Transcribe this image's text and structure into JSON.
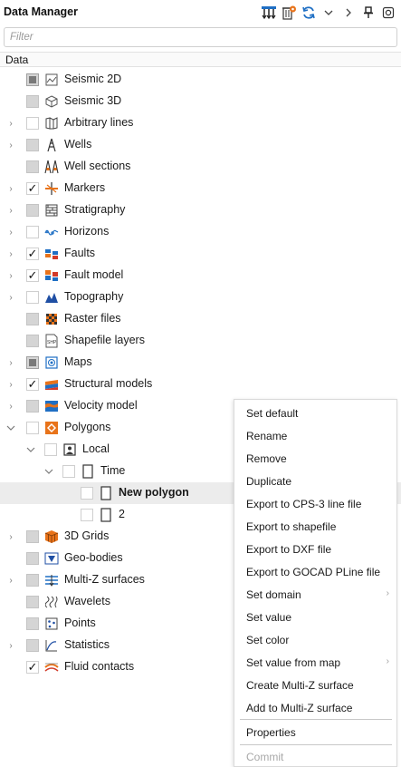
{
  "header": {
    "title": "Data Manager",
    "icons": [
      "import-icon",
      "delete-settings-icon",
      "refresh-icon",
      "chevron-down-icon",
      "chevron-right-icon",
      "pin-icon",
      "settings-icon"
    ]
  },
  "filter": {
    "placeholder": "Filter",
    "value": ""
  },
  "column_header": "Data",
  "tree": {
    "items": [
      {
        "label": "Seismic 2D",
        "icon": "seismic-2d-icon",
        "expandable": false,
        "check": "partial-dark"
      },
      {
        "label": "Seismic 3D",
        "icon": "seismic-3d-icon",
        "expandable": false,
        "check": "partial"
      },
      {
        "label": "Arbitrary lines",
        "icon": "arbitrary-lines-icon",
        "expandable": true,
        "check": "empty"
      },
      {
        "label": "Wells",
        "icon": "wells-icon",
        "expandable": true,
        "check": "partial"
      },
      {
        "label": "Well sections",
        "icon": "well-sections-icon",
        "expandable": false,
        "check": "partial"
      },
      {
        "label": "Markers",
        "icon": "markers-icon",
        "expandable": true,
        "check": "checked"
      },
      {
        "label": "Stratigraphy",
        "icon": "stratigraphy-icon",
        "expandable": true,
        "check": "partial"
      },
      {
        "label": "Horizons",
        "icon": "horizons-icon",
        "expandable": true,
        "check": "empty"
      },
      {
        "label": "Faults",
        "icon": "faults-icon",
        "expandable": true,
        "check": "checked"
      },
      {
        "label": "Fault model",
        "icon": "fault-model-icon",
        "expandable": true,
        "check": "checked"
      },
      {
        "label": "Topography",
        "icon": "topography-icon",
        "expandable": true,
        "check": "empty"
      },
      {
        "label": "Raster files",
        "icon": "raster-files-icon",
        "expandable": false,
        "check": "partial"
      },
      {
        "label": "Shapefile layers",
        "icon": "shapefile-icon",
        "expandable": false,
        "check": "partial"
      },
      {
        "label": "Maps",
        "icon": "maps-icon",
        "expandable": true,
        "check": "partial-dark"
      },
      {
        "label": "Structural models",
        "icon": "structural-models-icon",
        "expandable": true,
        "check": "checked"
      },
      {
        "label": "Velocity model",
        "icon": "velocity-model-icon",
        "expandable": true,
        "check": "partial"
      },
      {
        "label": "Polygons",
        "icon": "polygons-icon",
        "expandable": true,
        "expanded": true,
        "check": "empty"
      },
      {
        "label": "Local",
        "icon": "user-folder-icon",
        "expandable": true,
        "expanded": true,
        "check": "empty"
      },
      {
        "label": "Time",
        "icon": "document-icon",
        "expandable": true,
        "expanded": true,
        "check": "empty"
      },
      {
        "label": "New polygon",
        "icon": "document-icon",
        "expandable": false,
        "check": "empty",
        "selected": true
      },
      {
        "label": "2",
        "icon": "document-icon",
        "expandable": false,
        "check": "empty"
      },
      {
        "label": "3D Grids",
        "icon": "3d-grids-icon",
        "expandable": true,
        "check": "partial"
      },
      {
        "label": "Geo-bodies",
        "icon": "geo-bodies-icon",
        "expandable": false,
        "check": "partial"
      },
      {
        "label": "Multi-Z surfaces",
        "icon": "multi-z-surfaces-icon",
        "expandable": true,
        "check": "partial"
      },
      {
        "label": "Wavelets",
        "icon": "wavelets-icon",
        "expandable": false,
        "check": "partial"
      },
      {
        "label": "Points",
        "icon": "points-icon",
        "expandable": false,
        "check": "partial"
      },
      {
        "label": "Statistics",
        "icon": "statistics-icon",
        "expandable": true,
        "check": "partial"
      },
      {
        "label": "Fluid contacts",
        "icon": "fluid-contacts-icon",
        "expandable": false,
        "check": "checked"
      }
    ]
  },
  "context_menu": {
    "items": [
      {
        "label": "Set default"
      },
      {
        "label": "Rename"
      },
      {
        "label": "Remove"
      },
      {
        "label": "Duplicate"
      },
      {
        "label": "Export to CPS-3 line file"
      },
      {
        "label": "Export to shapefile"
      },
      {
        "label": "Export to DXF file"
      },
      {
        "label": "Export to GOCAD PLine file"
      },
      {
        "label": "Set domain",
        "submenu": true
      },
      {
        "label": "Set value"
      },
      {
        "label": "Set color"
      },
      {
        "label": "Set value from map",
        "submenu": true
      },
      {
        "label": "Create Multi-Z surface"
      },
      {
        "label": "Add to Multi-Z surface"
      },
      {
        "label": "Properties"
      },
      {
        "label": "Commit",
        "disabled": true
      }
    ]
  },
  "colors": {
    "selected_row": "#ececec",
    "accent_blue": "#1f6fc4",
    "accent_orange": "#e8731a",
    "accent_red": "#d23a2a"
  }
}
